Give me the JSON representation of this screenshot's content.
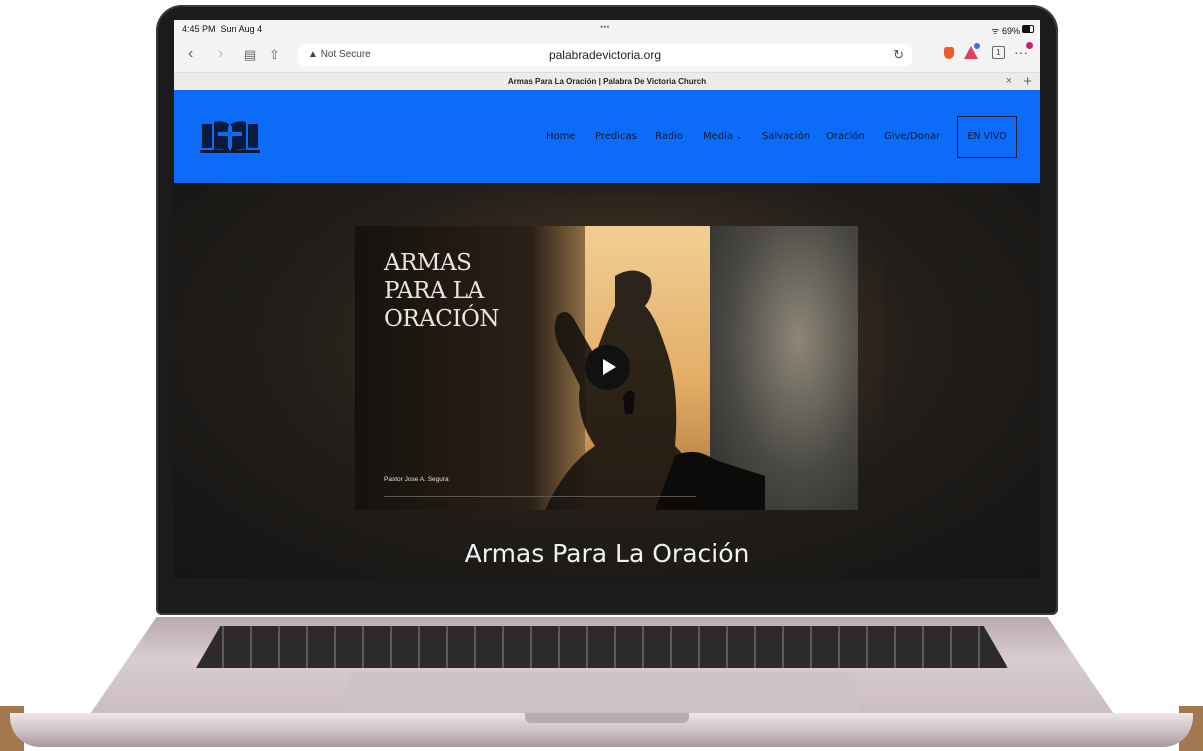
{
  "status_bar": {
    "time": "4:45 PM",
    "date": "Sun Aug 4",
    "dots": "•••",
    "battery": "69%"
  },
  "toolbar": {
    "back_icon": "chevron-left-icon",
    "forward_icon": "chevron-right-icon",
    "security_label": "Not Secure",
    "url": "palabradevictoria.org",
    "tab_count": "1",
    "more": "···"
  },
  "tab": {
    "title": "Armas Para La Oración | Palabra De Victoria Church",
    "close": "×",
    "new": "+"
  },
  "site": {
    "logo_icon": "open-bible-cross-icon",
    "nav": [
      {
        "label": "Home"
      },
      {
        "label": "Predicas"
      },
      {
        "label": "Radio"
      },
      {
        "label": "Media"
      },
      {
        "label": "Salvación"
      },
      {
        "label": "Oración"
      },
      {
        "label": "Give/Donar"
      }
    ],
    "live_button": "EN VIVO",
    "colors": {
      "header": "#0c6cf7",
      "nav_text": "#0b1a3a"
    }
  },
  "video": {
    "title_lines": [
      "ARMAS",
      "PARA LA",
      "ORACIÓN"
    ],
    "pastor": "Pastor Jose A. Segura",
    "play_icon": "play-icon"
  },
  "hero": {
    "title": "Armas Para La Oración"
  }
}
